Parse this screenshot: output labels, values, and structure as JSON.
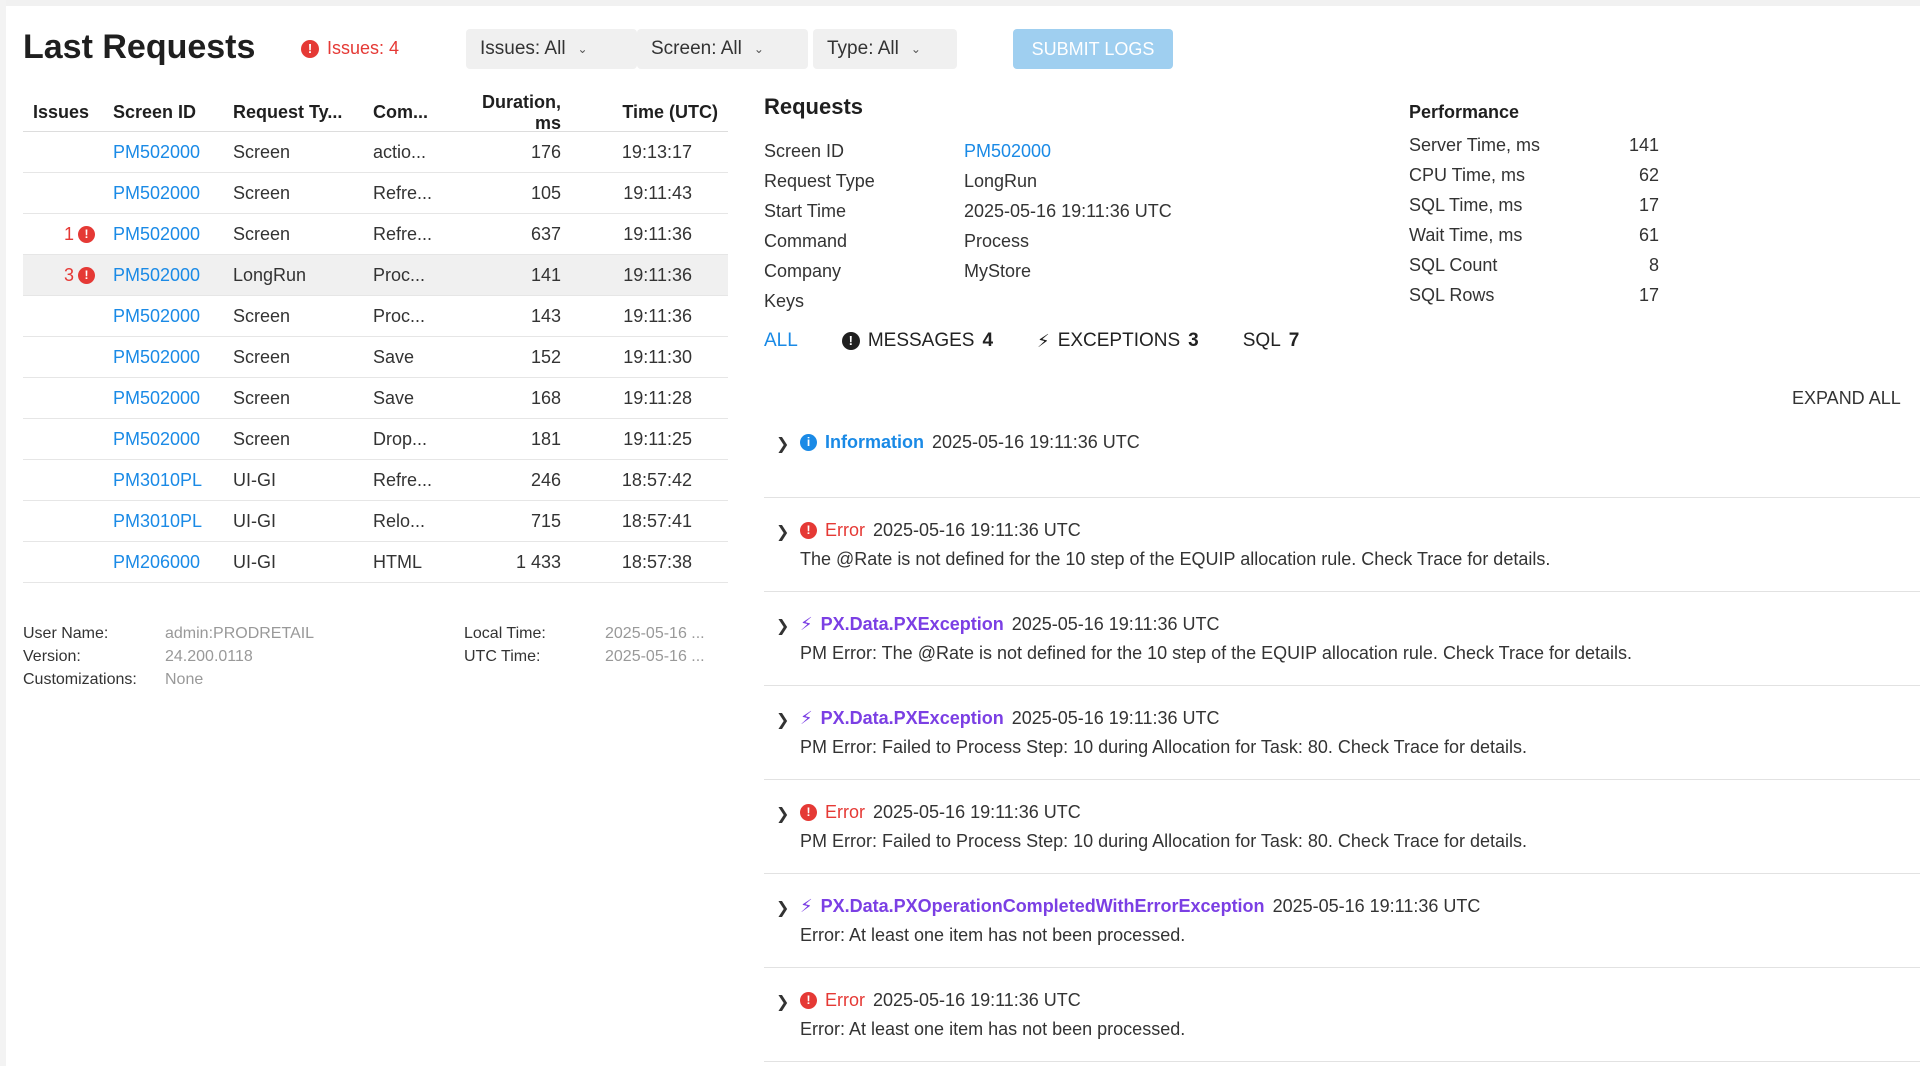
{
  "header": {
    "title": "Last Requests",
    "issues_label": "Issues: 4",
    "filters": [
      {
        "label": "Issues: All"
      },
      {
        "label": "Screen: All"
      },
      {
        "label": "Type: All"
      }
    ],
    "submit_label": "SUBMIT LOGS"
  },
  "table": {
    "columns": [
      "Issues",
      "Screen ID",
      "Request Ty...",
      "Com...",
      "Duration, ms",
      "Time (UTC)"
    ],
    "rows": [
      {
        "issues": "",
        "screen": "PM502000",
        "type": "Screen",
        "cmd": "actio...",
        "dur": "176",
        "time": "19:13:17"
      },
      {
        "issues": "",
        "screen": "PM502000",
        "type": "Screen",
        "cmd": "Refre...",
        "dur": "105",
        "time": "19:11:43"
      },
      {
        "issues": "1",
        "screen": "PM502000",
        "type": "Screen",
        "cmd": "Refre...",
        "dur": "637",
        "time": "19:11:36"
      },
      {
        "issues": "3",
        "screen": "PM502000",
        "type": "LongRun",
        "cmd": "Proc...",
        "dur": "141",
        "time": "19:11:36"
      },
      {
        "issues": "",
        "screen": "PM502000",
        "type": "Screen",
        "cmd": "Proc...",
        "dur": "143",
        "time": "19:11:36"
      },
      {
        "issues": "",
        "screen": "PM502000",
        "type": "Screen",
        "cmd": "Save",
        "dur": "152",
        "time": "19:11:30"
      },
      {
        "issues": "",
        "screen": "PM502000",
        "type": "Screen",
        "cmd": "Save",
        "dur": "168",
        "time": "19:11:28"
      },
      {
        "issues": "",
        "screen": "PM502000",
        "type": "Screen",
        "cmd": "Drop...",
        "dur": "181",
        "time": "19:11:25"
      },
      {
        "issues": "",
        "screen": "PM3010PL",
        "type": "UI-GI",
        "cmd": "Refre...",
        "dur": "246",
        "time": "18:57:42"
      },
      {
        "issues": "",
        "screen": "PM3010PL",
        "type": "UI-GI",
        "cmd": "Relo...",
        "dur": "715",
        "time": "18:57:41"
      },
      {
        "issues": "",
        "screen": "PM206000",
        "type": "UI-GI",
        "cmd": "HTML",
        "dur": "1 433",
        "time": "18:57:38"
      }
    ]
  },
  "footer": {
    "user_name_label": "User Name:",
    "user_name": "admin:PRODRETAIL",
    "version_label": "Version:",
    "version": "24.200.0118",
    "customizations_label": "Customizations:",
    "customizations": "None",
    "local_time_label": "Local Time:",
    "local_time": "2025-05-16 ...",
    "utc_time_label": "UTC Time:",
    "utc_time": "2025-05-16 ..."
  },
  "detail": {
    "title": "Requests",
    "fields": [
      {
        "k": "Screen ID",
        "v": "PM502000",
        "link": true
      },
      {
        "k": "Request Type",
        "v": "LongRun"
      },
      {
        "k": "Start Time",
        "v": "2025-05-16 19:11:36 UTC"
      },
      {
        "k": "Command",
        "v": "Process"
      },
      {
        "k": "Company",
        "v": "MyStore"
      },
      {
        "k": "Keys",
        "v": ""
      }
    ],
    "performance": {
      "title": "Performance",
      "rows": [
        {
          "k": "Server Time, ms",
          "v": "141"
        },
        {
          "k": "CPU Time, ms",
          "v": "62"
        },
        {
          "k": "SQL Time, ms",
          "v": "17"
        },
        {
          "k": "Wait Time, ms",
          "v": "61"
        },
        {
          "k": "SQL Count",
          "v": "8"
        },
        {
          "k": "SQL Rows",
          "v": "17"
        }
      ]
    },
    "tabs": {
      "all": "ALL",
      "messages": "MESSAGES",
      "messages_count": "4",
      "exceptions": "EXCEPTIONS",
      "exceptions_count": "3",
      "sql": "SQL",
      "sql_count": "7"
    },
    "expand_all": "EXPAND ALL",
    "messages": [
      {
        "level": "Information",
        "ts": "2025-05-16 19:11:36 UTC",
        "body": ""
      },
      {
        "level": "Error",
        "ts": "2025-05-16 19:11:36 UTC",
        "body": "The @Rate is not defined for the 10 step of the EQUIP allocation rule. Check Trace for details."
      },
      {
        "level": "PX.Data.PXException",
        "ts": "2025-05-16 19:11:36 UTC",
        "body": "PM Error: The @Rate is not defined for the 10 step of the EQUIP allocation rule. Check Trace for details."
      },
      {
        "level": "PX.Data.PXException",
        "ts": "2025-05-16 19:11:36 UTC",
        "body": "PM Error: Failed to Process Step: 10 during Allocation for Task: 80. Check Trace for details."
      },
      {
        "level": "Error",
        "ts": "2025-05-16 19:11:36 UTC",
        "body": "PM Error: Failed to Process Step: 10 during Allocation for Task: 80. Check Trace for details."
      },
      {
        "level": "PX.Data.PXOperationCompletedWithErrorException",
        "ts": "2025-05-16 19:11:36 UTC",
        "body": "Error: At least one item has not been processed."
      },
      {
        "level": "Error",
        "ts": "2025-05-16 19:11:36 UTC",
        "body": "Error: At least one item has not been processed."
      }
    ]
  },
  "colors": {
    "accent": "#1a8ae6",
    "error": "#e53935",
    "exception": "#7b3fe4",
    "submit_bg": "#9fcff0"
  }
}
